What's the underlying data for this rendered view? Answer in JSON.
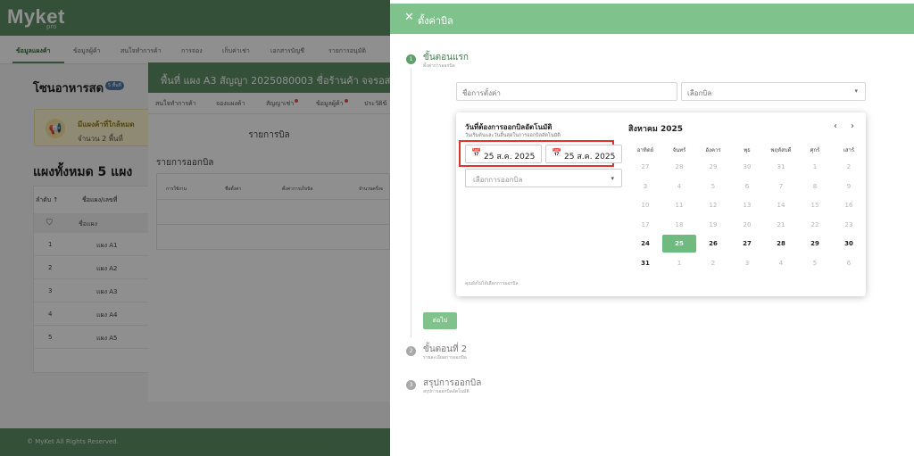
{
  "background": {
    "logo": "Myket",
    "logo_sub": "pro",
    "nav_tabs": [
      "ข้อมูลแผงค้า",
      "ข้อมูลผู้ค้า",
      "สนใจทำการค้า",
      "การจอง",
      "เก็บค่าเช่า",
      "เอกสารบัญชี",
      "รายการอนุมัติ"
    ],
    "zone_title": "โซนอาหารสด",
    "zone_badge": "5 พื้นที่",
    "notice_line1": "มีแผงค้าที่ใกล้หมด",
    "notice_line2": "จำนวน 2 พื้นที่",
    "stalls_title": "แผงทั้งหมด 5 แผง",
    "table_headers": [
      "ลำดับ ↑",
      "ชื่อแผง/เลขที่"
    ],
    "filter_label": "ชื่อแผง",
    "rows": [
      {
        "no": "1",
        "name": "แผง A1"
      },
      {
        "no": "2",
        "name": "แผง A2"
      },
      {
        "no": "3",
        "name": "แผง A3"
      },
      {
        "no": "4",
        "name": "แผง A4"
      },
      {
        "no": "5",
        "name": "แผง A5"
      }
    ],
    "footer": "© MyKet All Rights Reserved."
  },
  "middle_modal": {
    "title": "พื้นที่ แผง A3 สัญญา 2025080003 ชื่อร้านค้า จจรอส",
    "tabs": [
      "สนใจทำการค้า",
      "จองแผงค้า",
      "สัญญาเช่า",
      "ข้อมูลผู้ค้า",
      "ประวัติข้"
    ],
    "section_title": "รายการบิล",
    "billing_title": "รายการออกบิล",
    "table_headers": [
      "การใช้งาน",
      "ชื่อตั้งค่า",
      "ตั้งค่าการเก็บบิล",
      "จำนวนครั้งจ"
    ]
  },
  "drawer": {
    "title": "ตั้งค่าบิล",
    "steps": [
      {
        "num": "1",
        "title": "ขั้นตอนแรก",
        "sub": "ตั้งค่าการออกบิล"
      },
      {
        "num": "2",
        "title": "ขั้นตอนที่ 2",
        "sub": "รายละเอียดการออกบิล"
      },
      {
        "num": "3",
        "title": "สรุปการออกบิล",
        "sub": "สรุปการออกบิลอัตโนมัติ"
      }
    ],
    "setting_name_placeholder": "ชื่อการตั้งค่า",
    "bill_select_placeholder": "เลือกบิล",
    "next_button": "ต่อไป"
  },
  "popup": {
    "title": "วันที่ต้องการออกบิลอัตโนมัติ",
    "subtitle": "วันเริ่มต้นและวันสิ้นสุดในการออกบิลอัตโนมัติ",
    "start_date": "25 ส.ค. 2025",
    "end_date": "25 ส.ค. 2025",
    "bill_type_placeholder": "เลือกการออกบิล",
    "note": "คุณยังไม่ได้เลือกการออกบิล",
    "highlight_color": "#e2322d"
  },
  "calendar": {
    "month": "สิงหาคม 2025",
    "prev": "‹",
    "next": "›",
    "weekdays": [
      "อาทิตย์",
      "จันทร์",
      "อังคาร",
      "พุธ",
      "พฤหัสบดี",
      "ศุกร์",
      "เสาร์"
    ],
    "weeks": [
      [
        "27",
        "28",
        "29",
        "30",
        "31",
        "1",
        "2"
      ],
      [
        "3",
        "4",
        "5",
        "6",
        "7",
        "8",
        "9"
      ],
      [
        "10",
        "11",
        "12",
        "13",
        "14",
        "15",
        "16"
      ],
      [
        "17",
        "18",
        "19",
        "20",
        "21",
        "22",
        "23"
      ],
      [
        "24",
        "25",
        "26",
        "27",
        "28",
        "29",
        "30"
      ],
      [
        "31",
        "1",
        "2",
        "3",
        "4",
        "5",
        "6"
      ]
    ],
    "selected": "25",
    "accent": "#6fba7f"
  }
}
